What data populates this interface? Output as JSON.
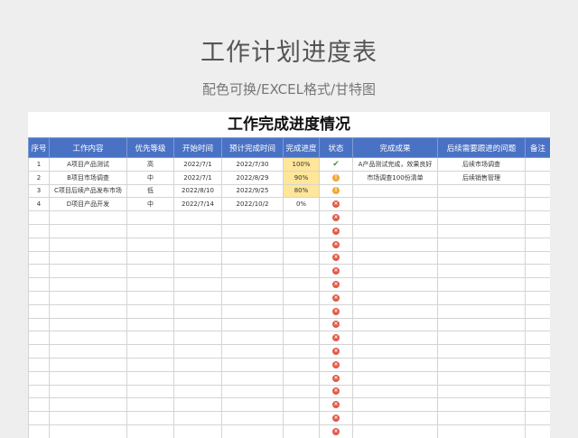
{
  "page": {
    "title": "工作计划进度表",
    "subtitle": "配色可换/EXCEL格式/甘特图"
  },
  "sheet": {
    "title": "工作完成进度情况",
    "headers": [
      "序号",
      "工作内容",
      "优先等级",
      "开始时间",
      "预计完成时间",
      "完成进度",
      "状态",
      "完成成果",
      "后续需要跟进的问题",
      "备注"
    ],
    "rows": [
      {
        "no": "1",
        "task": "A项目产品测试",
        "priority": "高",
        "start": "2022/7/1",
        "due": "2022/7/30",
        "progress": "100%",
        "status": "done",
        "result": "A产品测试完成，效果良好",
        "followup": "后续市场调查",
        "note": ""
      },
      {
        "no": "2",
        "task": "B项目市场调查",
        "priority": "中",
        "start": "2022/7/1",
        "due": "2022/8/29",
        "progress": "90%",
        "status": "warn",
        "result": "市场调查100份清单",
        "followup": "后续销售管理",
        "note": ""
      },
      {
        "no": "3",
        "task": "C项目后续产品发布市场",
        "priority": "低",
        "start": "2022/8/10",
        "due": "2022/9/25",
        "progress": "80%",
        "status": "warn",
        "result": "",
        "followup": "",
        "note": ""
      },
      {
        "no": "4",
        "task": "D项目产品开发",
        "priority": "中",
        "start": "2022/7/14",
        "due": "2022/10/2",
        "progress": "0%",
        "status": "fail",
        "result": "",
        "followup": "",
        "note": ""
      }
    ],
    "empty_rows": 17,
    "status_icons": {
      "done": "check-icon",
      "warn": "exclamation-icon",
      "fail": "cross-icon"
    },
    "colors": {
      "header_bg": "#4a72c4",
      "progress_fill": "#ffe699",
      "done": "#3a9b3a",
      "warn": "#f0a830",
      "fail": "#e05a4a"
    }
  }
}
